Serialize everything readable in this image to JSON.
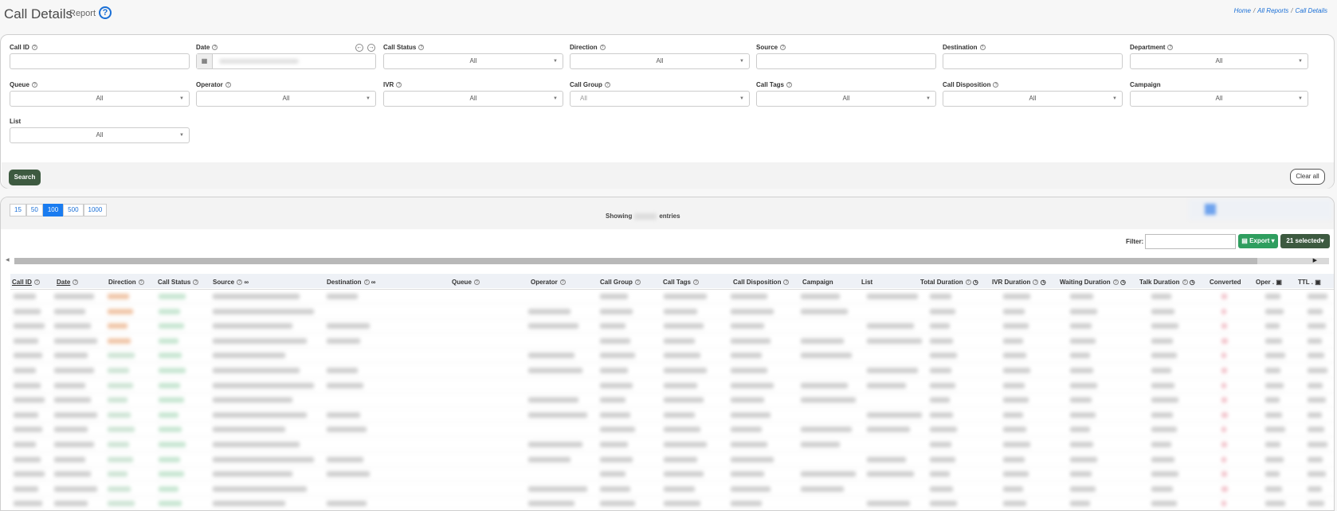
{
  "header": {
    "title": "Call Details",
    "subtitle": "Report",
    "help": "?",
    "breadcrumb": {
      "home": "Home",
      "sep1": "/",
      "reports": "All Reports",
      "sep2": "/",
      "current": "Call Details"
    }
  },
  "filters": {
    "call_id": {
      "label": "Call ID"
    },
    "date": {
      "label": "Date"
    },
    "call_status": {
      "label": "Call Status",
      "value": "All"
    },
    "direction": {
      "label": "Direction",
      "value": "All"
    },
    "source": {
      "label": "Source"
    },
    "destination": {
      "label": "Destination"
    },
    "department": {
      "label": "Department",
      "value": "All"
    },
    "queue": {
      "label": "Queue",
      "value": "All"
    },
    "operator": {
      "label": "Operator",
      "value": "All"
    },
    "ivr": {
      "label": "IVR",
      "value": "All"
    },
    "call_group": {
      "label": "Call Group",
      "value": "All"
    },
    "call_tags": {
      "label": "Call Tags",
      "value": "All"
    },
    "call_disposition": {
      "label": "Call Disposition",
      "value": "All"
    },
    "campaign": {
      "label": "Campaign",
      "value": "All"
    },
    "list": {
      "label": "List",
      "value": "All"
    },
    "search_label": "Search",
    "clear_label": "Clear all"
  },
  "table": {
    "page_sizes": [
      "15",
      "50",
      "100",
      "500",
      "1000"
    ],
    "active_page_size": "100",
    "showing_prefix": "Showing",
    "showing_suffix": "entries",
    "filter_label": "Filter:",
    "export_label": "Export",
    "selected_label": "21 selected",
    "columns": [
      "Call ID",
      "Date",
      "Direction",
      "Call Status",
      "Source",
      "Destination",
      "Queue",
      "Operator",
      "Call Group",
      "Call Tags",
      "Call Disposition",
      "Campaign",
      "List",
      "Total Duration",
      "IVR Duration",
      "Waiting Duration",
      "Talk Duration",
      "Converted",
      "Oper .",
      "TTL ."
    ]
  },
  "colors": {
    "accent": "#1a6fd6",
    "primary_btn": "#3d5a40",
    "export_btn": "#2f9e5f",
    "active_page": "#1a7cf0"
  }
}
